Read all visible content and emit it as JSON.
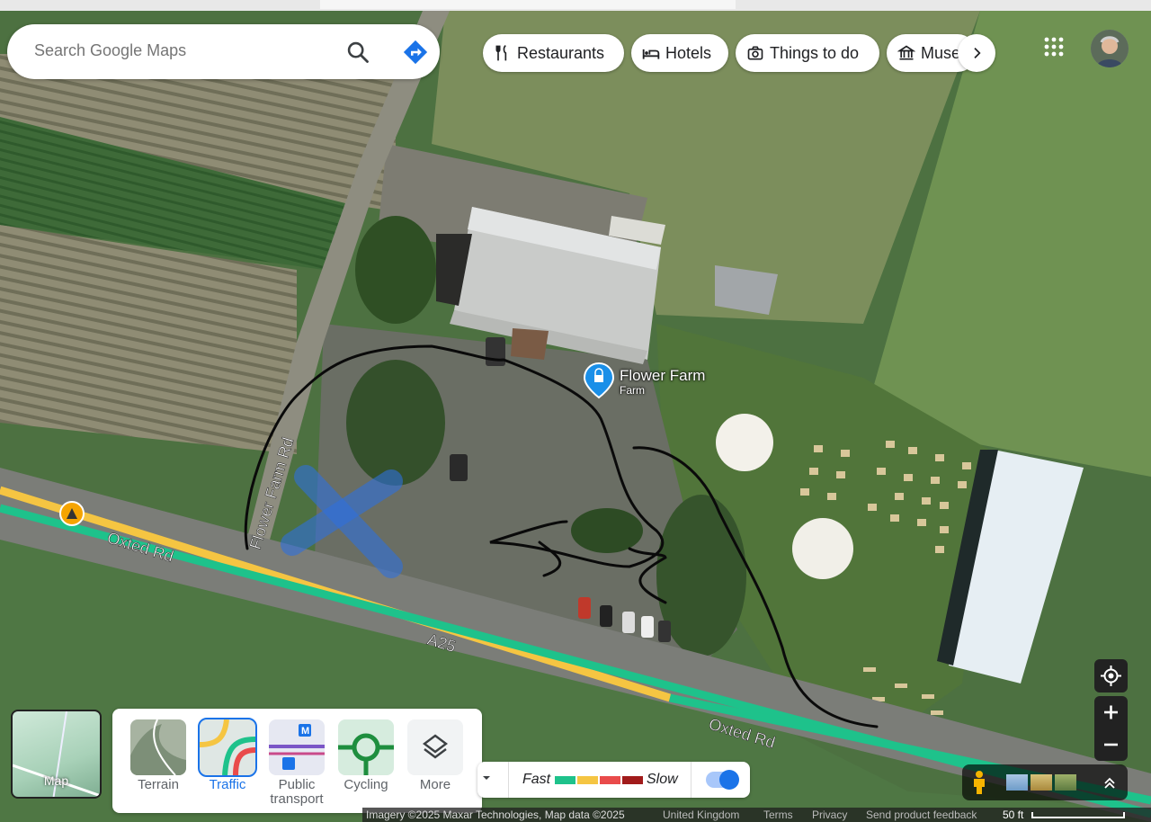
{
  "search": {
    "placeholder": "Search Google Maps"
  },
  "chips": [
    {
      "label": "Restaurants",
      "icon": "fork-knife-icon"
    },
    {
      "label": "Hotels",
      "icon": "bed-icon"
    },
    {
      "label": "Things to do",
      "icon": "camera-icon"
    },
    {
      "label": "Muse",
      "icon": "museum-icon"
    }
  ],
  "place": {
    "name": "Flower Farm",
    "category": "Farm"
  },
  "roads": {
    "flower_farm_rd": "Flower Farm Rd",
    "oxted_rd_west": "Oxted Rd",
    "a25": "A25",
    "oxted_rd_east": "Oxted Rd"
  },
  "map_type": {
    "label": "Map"
  },
  "layers": [
    {
      "label": "Terrain",
      "active": false
    },
    {
      "label": "Traffic",
      "active": true
    },
    {
      "label": "Public transport",
      "active": false
    },
    {
      "label": "Cycling",
      "active": false
    },
    {
      "label": "More",
      "active": false
    }
  ],
  "traffic_legend": {
    "fast_label": "Fast",
    "slow_label": "Slow",
    "colors": [
      "#1ec28b",
      "#f5c542",
      "#e94b4b",
      "#a11b1b"
    ],
    "toggle_on": true
  },
  "footer": {
    "imagery": "Imagery ©2025 Maxar Technologies, Map data ©2025",
    "region": "United Kingdom",
    "terms": "Terms",
    "privacy": "Privacy",
    "feedback": "Send product feedback",
    "scale": "50 ft"
  },
  "colors": {
    "accent": "#1a73e8",
    "traffic_green": "#1ec28b",
    "traffic_yellow": "#f5c542"
  }
}
